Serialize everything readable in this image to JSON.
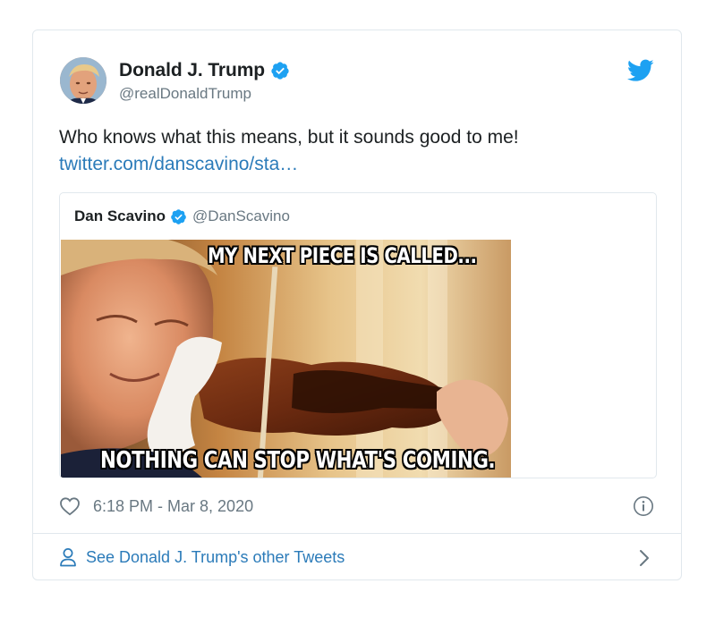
{
  "tweet": {
    "author_name": "Donald J. Trump",
    "author_handle": "@realDonaldTrump",
    "text": "Who knows what this means, but it sounds good to me!",
    "link": "twitter.com/danscavino/sta…",
    "timestamp": "6:18 PM - Mar 8, 2020",
    "see_more": "See Donald J. Trump's other Tweets"
  },
  "quoted": {
    "author_name": "Dan Scavino",
    "author_handle": "@DanScavino",
    "image_top_text": "MY NEXT PIECE IS CALLED...",
    "image_bottom_text": "NOTHING CAN STOP WHAT'S COMING."
  },
  "icons": {
    "verified": "verified-badge-icon",
    "twitter": "twitter-bird-icon",
    "like": "heart-icon",
    "info": "info-icon",
    "profile": "person-icon",
    "chevron": "chevron-right-icon"
  },
  "colors": {
    "accent": "#1da1f2",
    "link": "#2b7bb9",
    "text": "#1c2022",
    "muted": "#697882",
    "border": "#e1e8ed"
  }
}
